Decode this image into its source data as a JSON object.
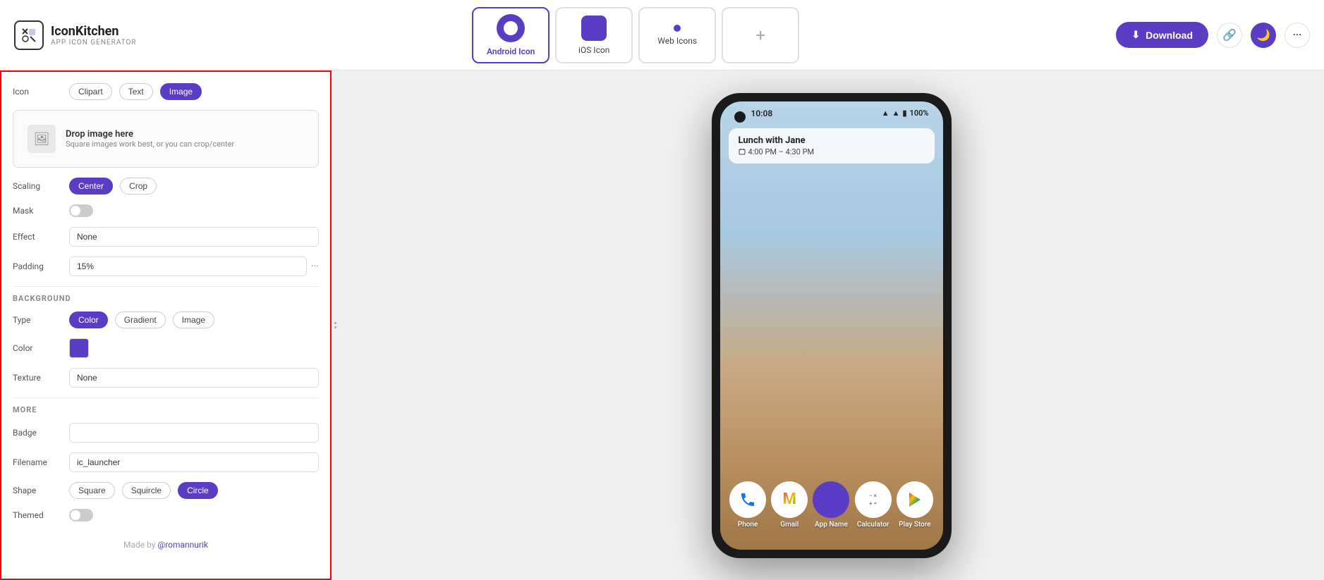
{
  "app": {
    "name": "IconKitchen",
    "subtitle": "APP ICON GENERATOR"
  },
  "header": {
    "tabs": [
      {
        "id": "android",
        "label": "Android Icon",
        "active": true
      },
      {
        "id": "ios",
        "label": "iOS Icon",
        "active": false
      },
      {
        "id": "web",
        "label": "Web Icons",
        "active": false
      },
      {
        "id": "add",
        "label": "+",
        "active": false
      }
    ],
    "download_label": "Download",
    "link_icon": "🔗",
    "theme_icon": "🌙",
    "more_icon": "···"
  },
  "sidebar": {
    "icon_label": "Icon",
    "icon_tabs": [
      "Clipart",
      "Text",
      "Image"
    ],
    "icon_active_tab": "Image",
    "drop_title": "Drop image here",
    "drop_subtitle": "Square images work best, or you can crop/center",
    "scaling_label": "Scaling",
    "scaling_options": [
      "Center",
      "Crop"
    ],
    "scaling_active": "Center",
    "mask_label": "Mask",
    "effect_label": "Effect",
    "effect_value": "None",
    "padding_label": "Padding",
    "padding_value": "15%",
    "background_section": "BACKGROUND",
    "type_label": "Type",
    "type_options": [
      "Color",
      "Gradient",
      "Image"
    ],
    "type_active": "Color",
    "color_label": "Color",
    "color_value": "#5b3cc4",
    "texture_label": "Texture",
    "texture_value": "None",
    "more_section": "MORE",
    "badge_label": "Badge",
    "filename_label": "Filename",
    "filename_value": "ic_launcher",
    "shape_label": "Shape",
    "shape_options": [
      "Square",
      "Squircle",
      "Circle"
    ],
    "shape_active": "Circle",
    "themed_label": "Themed",
    "footer_text": "Made by ",
    "footer_link": "@romannurik"
  },
  "preview": {
    "time": "10:08",
    "battery": "100%",
    "notification_title": "Lunch with Jane",
    "notification_time": "4:00 PM – 4:30 PM",
    "apps": [
      {
        "name": "Phone",
        "type": "phone"
      },
      {
        "name": "Gmail",
        "type": "gmail"
      },
      {
        "name": "App Name",
        "type": "appname"
      },
      {
        "name": "Calculator",
        "type": "calculator"
      },
      {
        "name": "Play Store",
        "type": "playstore"
      }
    ]
  }
}
